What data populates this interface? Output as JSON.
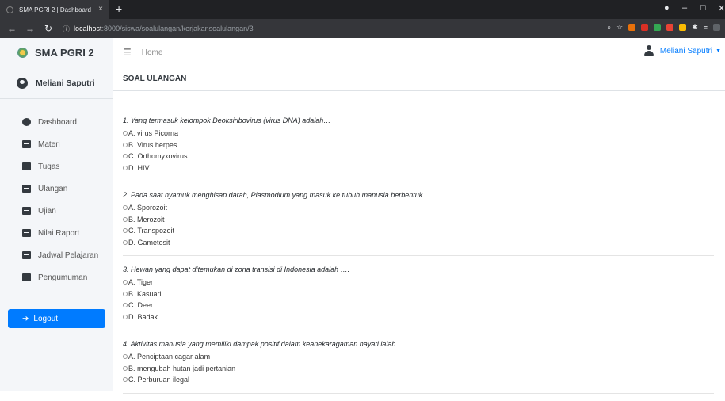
{
  "browser": {
    "tab_title": "SMA PGRI 2 | Dashboard",
    "tab_close": "×",
    "new_tab": "+",
    "url_host": "localhost",
    "url_path": ":8000/siswa/soalulangan/kerjakansoalulangan/3"
  },
  "brand": {
    "name": "SMA PGRI 2"
  },
  "user": {
    "name": "Meliani Saputri",
    "menu_name": "Meliani Saputri"
  },
  "topnav": {
    "home": "Home"
  },
  "sidebar": {
    "items": [
      {
        "label": "Dashboard"
      },
      {
        "label": "Materi"
      },
      {
        "label": "Tugas"
      },
      {
        "label": "Ulangan"
      },
      {
        "label": "Ujian"
      },
      {
        "label": "Nilai Raport"
      },
      {
        "label": "Jadwal Pelajaran"
      },
      {
        "label": "Pengumuman"
      }
    ],
    "logout": "Logout"
  },
  "page": {
    "title": "SOAL ULANGAN"
  },
  "questions": [
    {
      "text": "1. Yang termasuk kelompok Deoksiribovirus (virus DNA) adalah…",
      "options": [
        "A. virus Picorna",
        "B. Virus herpes",
        "C. Orthomyxovirus",
        "D. HIV"
      ]
    },
    {
      "text": "2. Pada saat nyamuk menghisap darah, Plasmodium yang masuk ke tubuh manusia berbentuk ….",
      "options": [
        "A. Sporozoit",
        "B. Merozoit",
        "C. Transpozoit",
        "D. Gametosit"
      ]
    },
    {
      "text": "3. Hewan yang dapat ditemukan di zona transisi di Indonesia adalah ….",
      "options": [
        "A. Tiger",
        "B. Kasuari",
        "C. Deer",
        "D. Badak"
      ]
    },
    {
      "text": "4. Aktivitas manusia yang memiliki dampak positif dalam keanekaragaman hayati ialah ….",
      "options": [
        "A. Penciptaan cagar alam",
        "B. mengubah hutan jadi pertanian",
        "C. Perburuan ilegal"
      ]
    }
  ],
  "colors": {
    "accent": "#007bff",
    "chrome": "#35363a"
  }
}
